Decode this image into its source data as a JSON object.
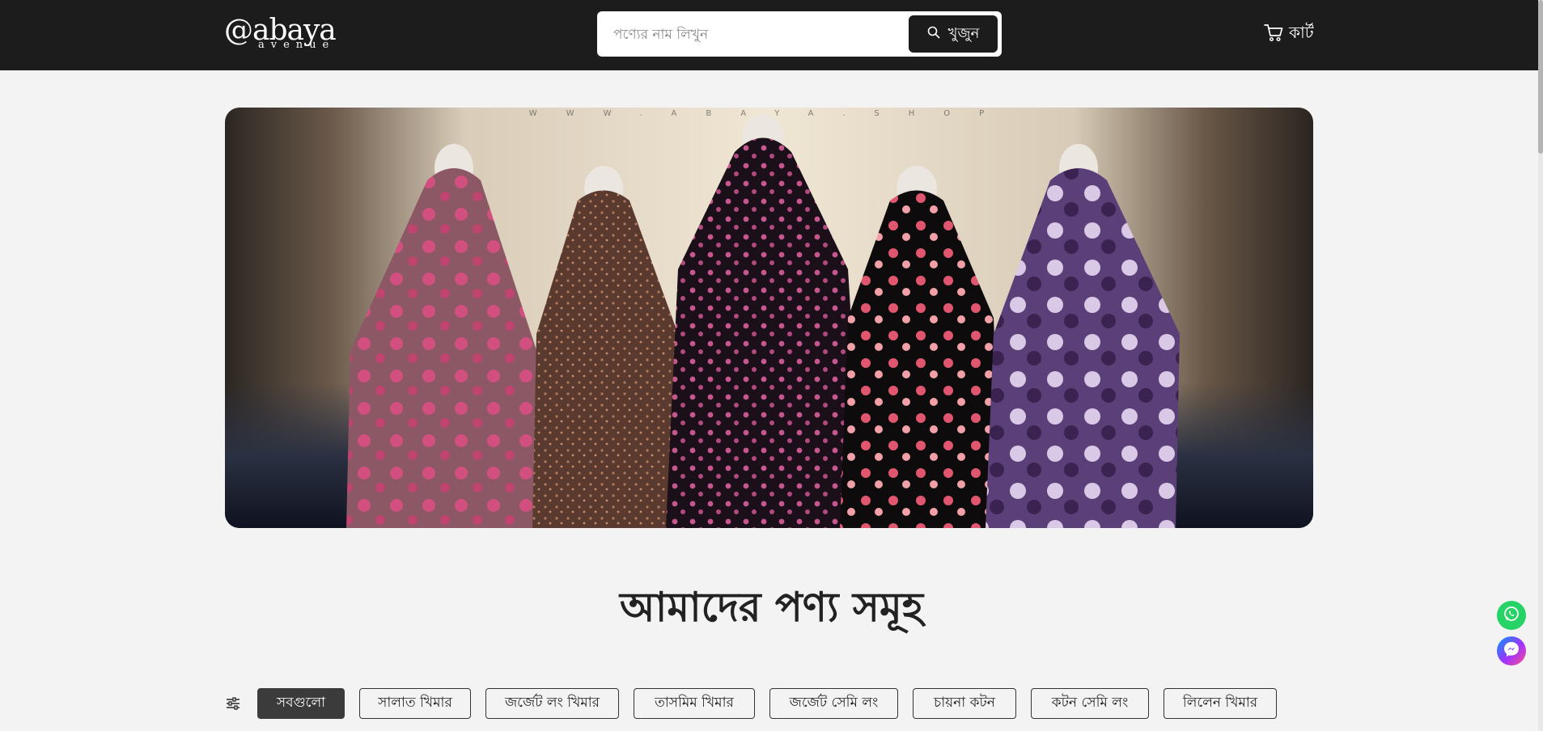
{
  "header": {
    "logo_main": "@abaya",
    "logo_sub": "avenue",
    "search_placeholder": "পণ্যের নাম লিখুন",
    "search_button": "খুজুন",
    "cart_label": "কার্ট"
  },
  "banner": {
    "watermark": "WWW.ABAYA.SHOP"
  },
  "main": {
    "heading": "আমাদের পণ্য সমূহ",
    "categories": [
      "সবগুলো",
      "সালাত খিমার",
      "জর্জেট লং খিমার",
      "তাসমিম খিমার",
      "জর্জেট সেমি লং",
      "চায়না কটন",
      "কটন সেমি লং",
      "লিলেন খিমার"
    ],
    "active_category": "সবগুলো"
  },
  "colors": {
    "header_bg": "#1c1c1c",
    "page_bg": "#f3f3f3",
    "active_category_bg": "#3b3b3b",
    "whatsapp": "#25d366",
    "messenger_start": "#0099ff",
    "messenger_end": "#ff4f8b"
  },
  "icons": {
    "search": "search-icon",
    "cart": "cart-icon",
    "filter": "filter-sliders-icon",
    "whatsapp": "whatsapp-icon",
    "messenger": "messenger-icon"
  }
}
